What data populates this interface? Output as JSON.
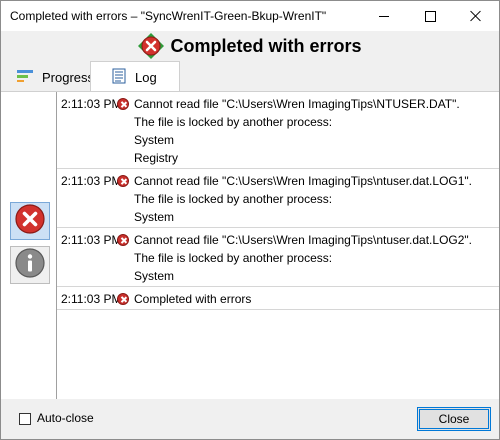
{
  "window": {
    "title": "Completed with errors – \"SyncWrenIT-Green-Bkup-WrenIT\""
  },
  "header": {
    "title": "Completed with errors"
  },
  "tabs": [
    {
      "label": "Progress"
    },
    {
      "label": "Log"
    }
  ],
  "log": [
    {
      "time": "2:11:03 PM",
      "status": "error",
      "lines": [
        "Cannot read file \"C:\\Users\\Wren ImagingTips\\NTUSER.DAT\".",
        "The file is locked by another process:",
        "System",
        "Registry"
      ]
    },
    {
      "time": "2:11:03 PM",
      "status": "error",
      "lines": [
        "Cannot read file \"C:\\Users\\Wren ImagingTips\\ntuser.dat.LOG1\".",
        "The file is locked by another process:",
        "System"
      ]
    },
    {
      "time": "2:11:03 PM",
      "status": "error",
      "lines": [
        "Cannot read file \"C:\\Users\\Wren ImagingTips\\ntuser.dat.LOG2\".",
        "The file is locked by another process:",
        "System"
      ]
    },
    {
      "time": "2:11:03 PM",
      "status": "error",
      "lines": [
        "Completed with errors"
      ]
    }
  ],
  "footer": {
    "auto_close_label": "Auto-close",
    "auto_close_checked": false,
    "close_label": "Close"
  },
  "colors": {
    "error_red": "#c9302c",
    "selected_blue": "#cce0f5",
    "accent_blue": "#0078d7"
  },
  "icons": {
    "header": "error-icon",
    "progress_tab": "progress-bars-icon",
    "log_tab": "log-list-icon",
    "filter_errors": "error-icon",
    "filter_info": "info-icon",
    "row": "error-icon"
  }
}
